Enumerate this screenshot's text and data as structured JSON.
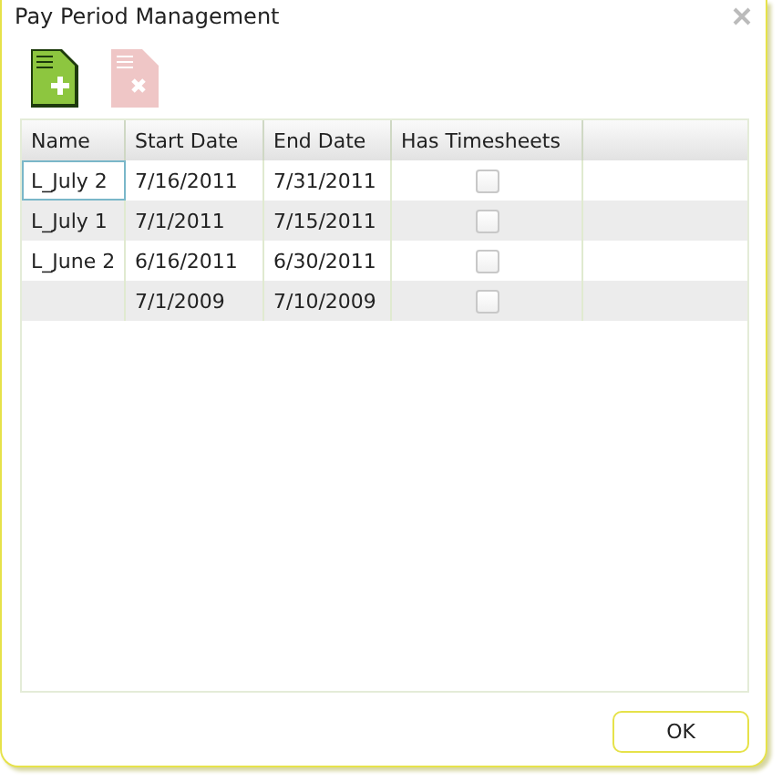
{
  "window": {
    "title": "Pay Period Management"
  },
  "toolbar": [
    {
      "kind": "add",
      "disabled": false
    },
    {
      "kind": "delete",
      "disabled": true
    }
  ],
  "table": {
    "columns": [
      "Name",
      "Start Date",
      "End Date",
      "Has Timesheets"
    ],
    "rows": [
      {
        "name": "L_July 2",
        "start": "7/16/2011",
        "end": "7/31/2011",
        "has_timesheets": false,
        "selected": true
      },
      {
        "name": "L_July 1",
        "start": "7/1/2011",
        "end": "7/15/2011",
        "has_timesheets": false,
        "selected": false
      },
      {
        "name": "L_June 2",
        "start": "6/16/2011",
        "end": "6/30/2011",
        "has_timesheets": false,
        "selected": false
      },
      {
        "name": "",
        "start": "7/1/2009",
        "end": "7/10/2009",
        "has_timesheets": false,
        "selected": false
      }
    ]
  },
  "buttons": [
    "OK"
  ]
}
